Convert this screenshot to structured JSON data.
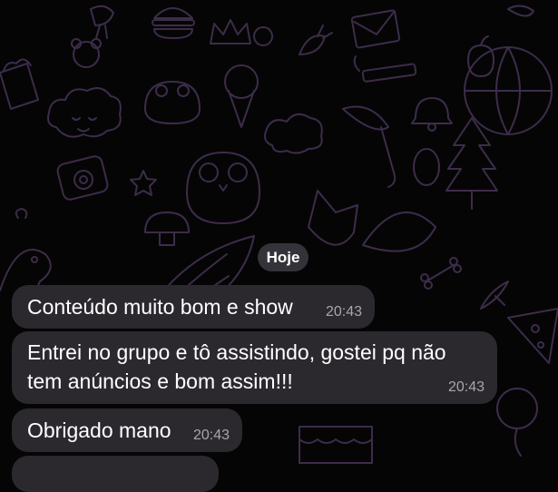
{
  "chat": {
    "date_divider": "Hoje",
    "messages": [
      {
        "text": "Conteúdo muito bom e show",
        "time": "20:43"
      },
      {
        "text": "Entrei no grupo e tô assistindo, gostei pq não\ntem anúncios e bom assim!!!",
        "time": "20:43"
      },
      {
        "text": "Obrigado mano",
        "time": "20:43"
      }
    ]
  },
  "colors": {
    "background": "#050505",
    "bubble": "#2b292e",
    "date_pill": "#3c3a42",
    "timestamp": "#a8a6ad",
    "doodle_stroke": "#3d2c4a"
  },
  "wallpaper": {
    "icons": [
      "bird-icon",
      "burger-icon",
      "crown-icon",
      "carrot-icon",
      "envelope-icon",
      "apple-icon",
      "teddy-bear-icon",
      "popcorn-icon",
      "cloud-icon",
      "frog-icon",
      "ice-cream-icon",
      "candle-icon",
      "bell-icon",
      "umbrella-icon",
      "camera-icon",
      "star-icon",
      "owl-icon",
      "tree-icon",
      "egg-icon",
      "mushroom-icon",
      "dinosaur-icon",
      "wing-icon",
      "fox-icon",
      "bone-icon",
      "rocket-icon",
      "globe-icon",
      "pizza-icon"
    ]
  }
}
